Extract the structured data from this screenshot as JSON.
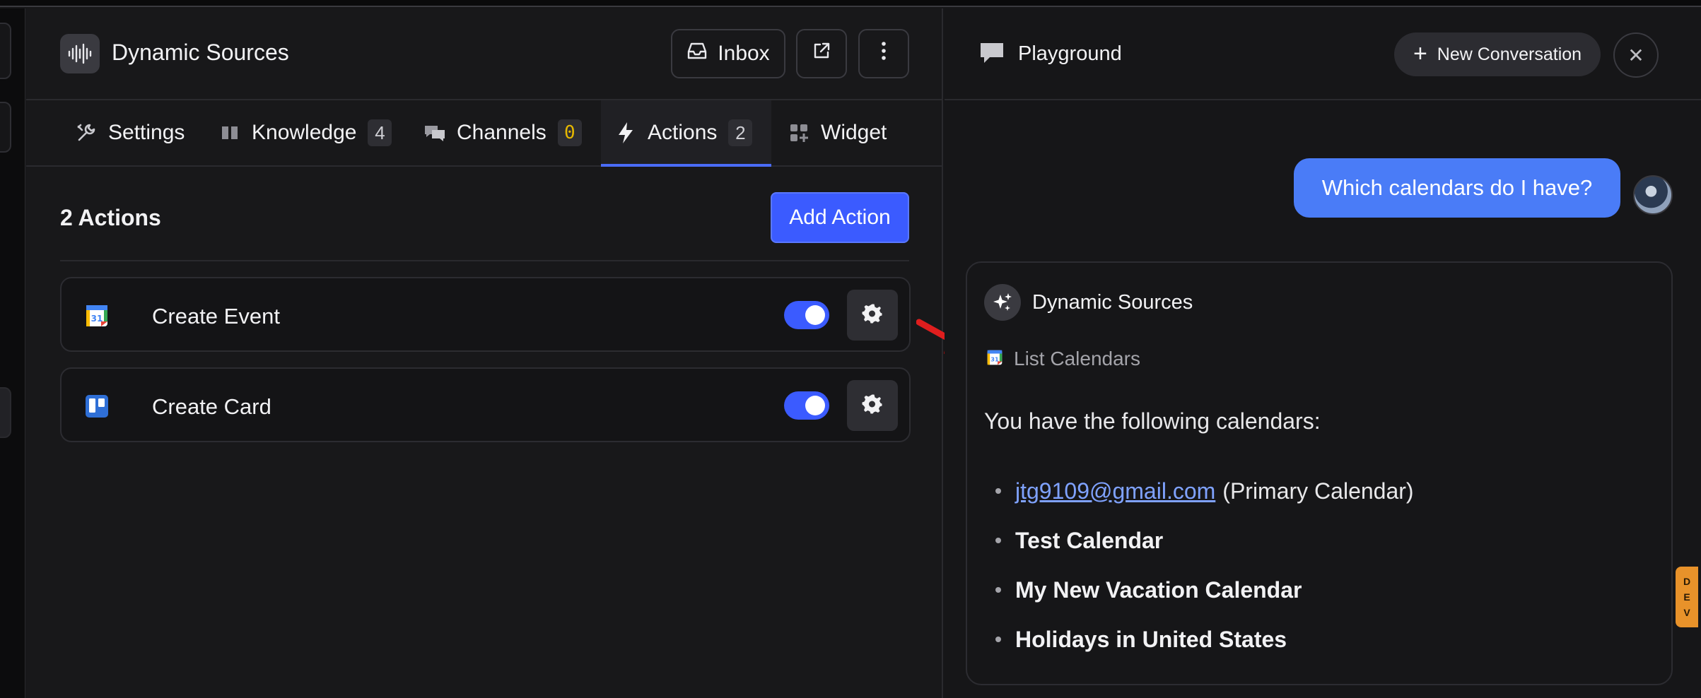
{
  "left_panel": {
    "title": "Dynamic Sources",
    "header_buttons": {
      "inbox_label": "Inbox"
    },
    "tabs": [
      {
        "label": "Settings",
        "icon": "tools-icon",
        "badge": null
      },
      {
        "label": "Knowledge",
        "icon": "book-icon",
        "badge": "4"
      },
      {
        "label": "Channels",
        "icon": "chat-bubbles-icon",
        "badge": "0"
      },
      {
        "label": "Actions",
        "icon": "bolt-icon",
        "badge": "2",
        "active": true
      },
      {
        "label": "Widget",
        "icon": "widget-grid-icon",
        "badge": null
      }
    ],
    "actions_heading": "2 Actions",
    "add_action_label": "Add Action",
    "actions": [
      {
        "name": "Create Event",
        "icon": "google-calendar-icon",
        "enabled": true
      },
      {
        "name": "Create Card",
        "icon": "trello-icon",
        "enabled": true
      }
    ]
  },
  "playground": {
    "title": "Playground",
    "new_conversation_label": "New Conversation",
    "user_message": "Which calendars do I have?",
    "assistant": {
      "name": "Dynamic Sources",
      "tool_call": "List Calendars",
      "intro": "You have the following calendars:",
      "calendars": [
        {
          "link": "jtg9109@gmail.com",
          "suffix": "(Primary Calendar)"
        },
        {
          "text": "Test Calendar"
        },
        {
          "text": "My New Vacation Calendar"
        },
        {
          "text": "Holidays in United States"
        }
      ]
    }
  },
  "dev_tab": [
    "D",
    "E",
    "V"
  ],
  "colors": {
    "accent": "#3b5bff",
    "user_bubble": "#4a7cf7",
    "link": "#7fa2ff",
    "channels_badge": "#e6b800",
    "dev_tab": "#e8922a",
    "arrow": "#e01e1e"
  }
}
